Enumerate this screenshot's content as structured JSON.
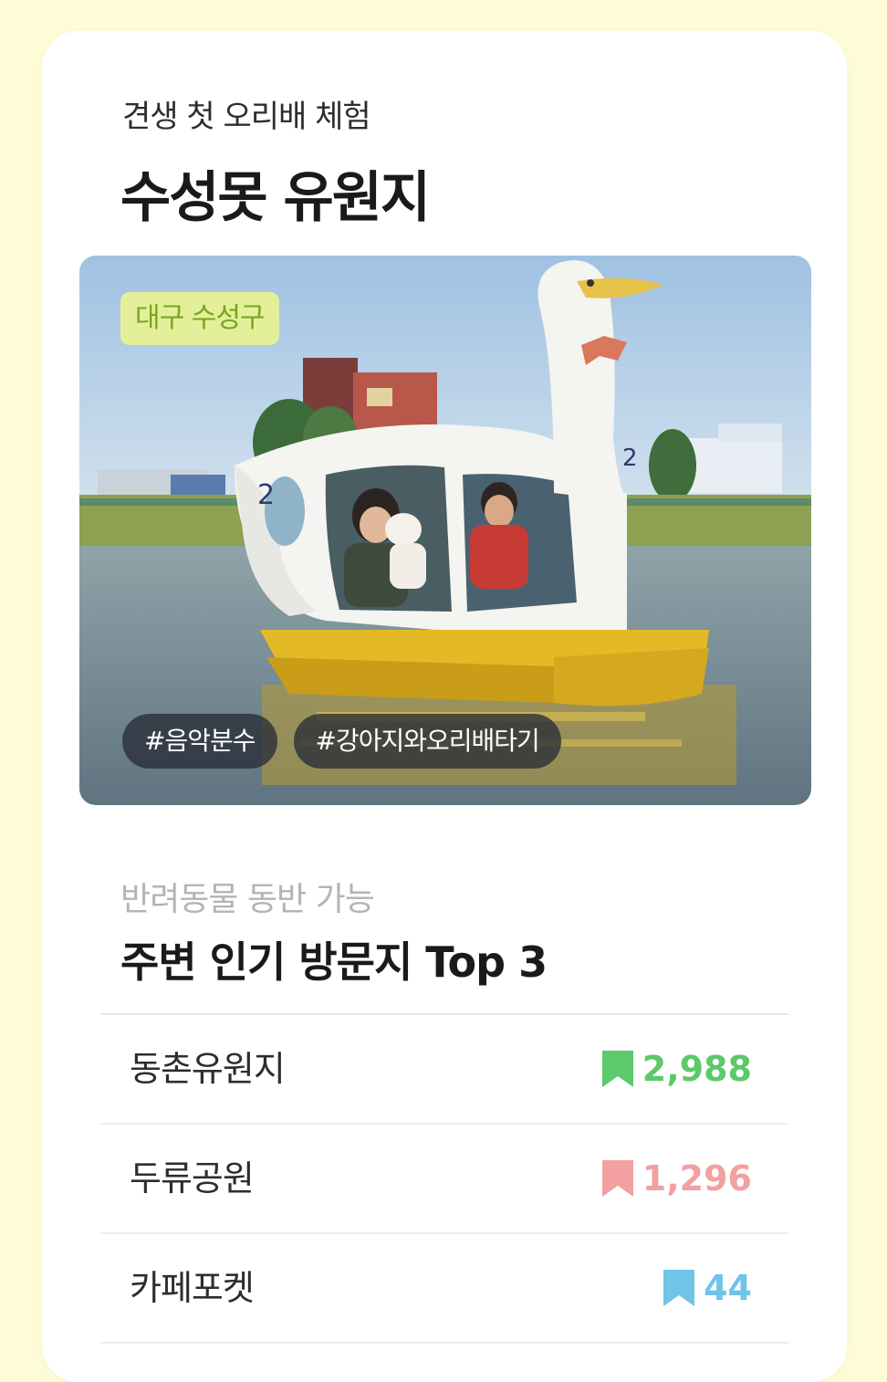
{
  "card": {
    "subtitle": "견생 첫 오리배 체험",
    "title": "수성못 유원지"
  },
  "photo": {
    "region_tag": "대구 수성구",
    "hashtags": [
      "#음악분수",
      "#강아지와오리배타기"
    ],
    "boat_number": "2"
  },
  "nearby": {
    "label": "반려동물 동반 가능",
    "title": "주변 인기 방문지 Top 3",
    "places": [
      {
        "name": "동촌유원지",
        "count": "2,988",
        "color": "#5cc96a",
        "icon": "bookmark-icon"
      },
      {
        "name": "두류공원",
        "count": "1,296",
        "color": "#f2a0a0",
        "icon": "bookmark-icon"
      },
      {
        "name": "카페포켓",
        "count": "44",
        "color": "#6fc4e8",
        "icon": "bookmark-icon"
      }
    ]
  }
}
